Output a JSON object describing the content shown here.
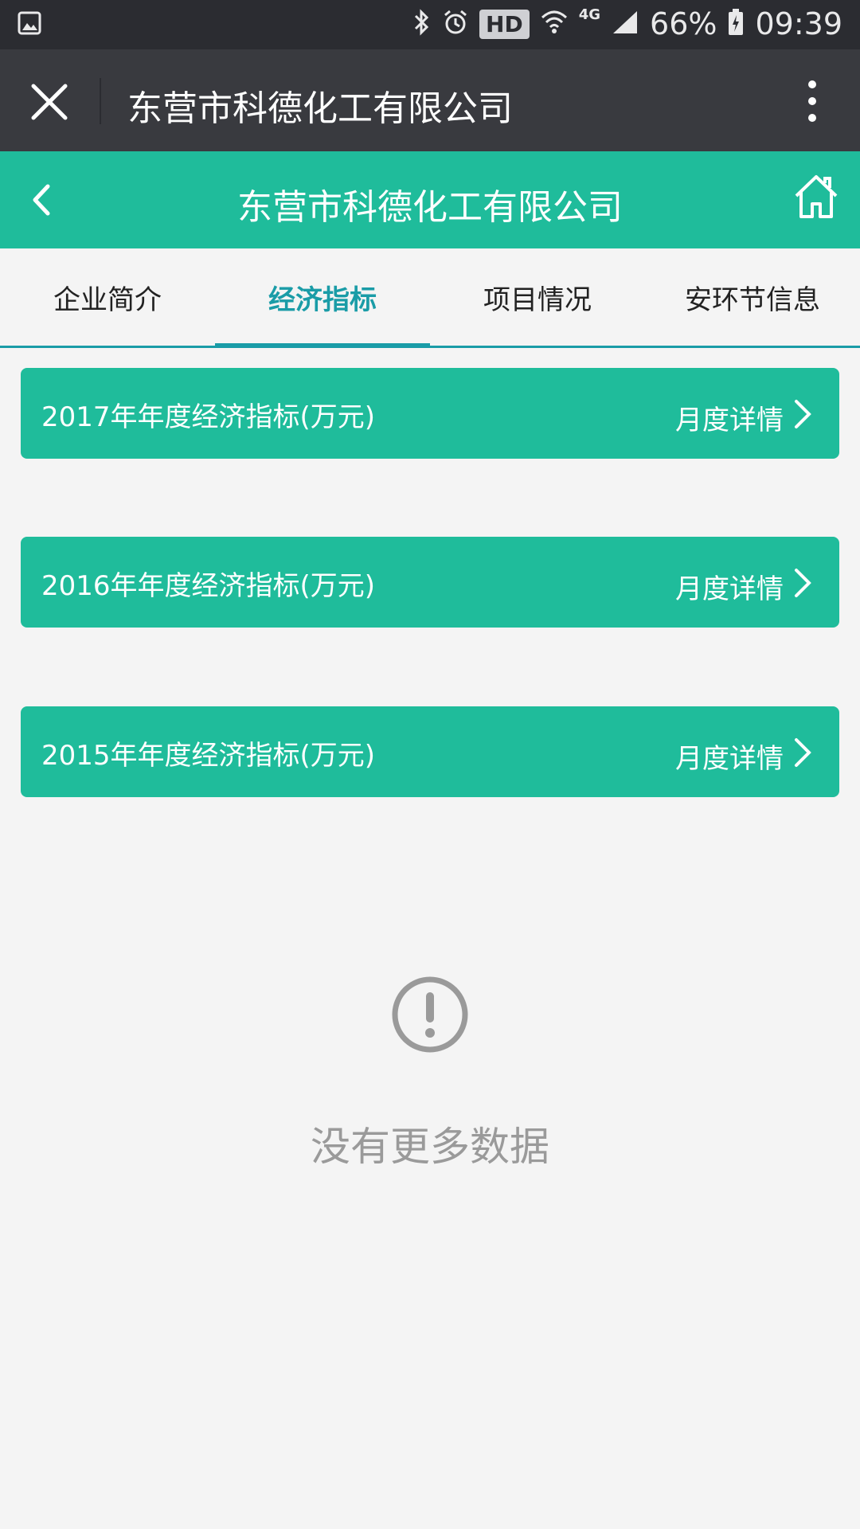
{
  "status": {
    "hd_badge": "HD",
    "network": "4G",
    "battery": "66%",
    "time": "09:39"
  },
  "wechat": {
    "title": "东营市科德化工有限公司"
  },
  "header": {
    "title": "东营市科德化工有限公司"
  },
  "tabs": [
    {
      "label": "企业简介",
      "active": false
    },
    {
      "label": "经济指标",
      "active": true
    },
    {
      "label": "项目情况",
      "active": false
    },
    {
      "label": "安环节信息",
      "active": false
    }
  ],
  "cards": [
    {
      "title": "2017年年度经济指标(万元)",
      "link": "月度详情"
    },
    {
      "title": "2016年年度经济指标(万元)",
      "link": "月度详情"
    },
    {
      "title": "2015年年度经济指标(万元)",
      "link": "月度详情"
    }
  ],
  "empty": {
    "text": "没有更多数据"
  },
  "colors": {
    "accent": "#1fbc9b",
    "tab_active": "#1a9ca7",
    "wechat_bar": "#393a3f",
    "status_bar": "#2b2c31"
  }
}
